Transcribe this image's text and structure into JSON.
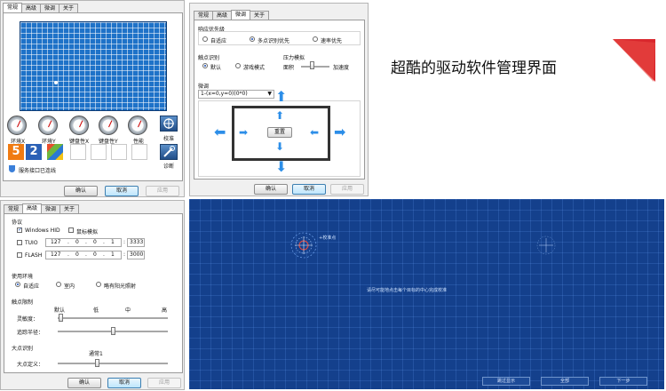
{
  "headline": "超酷的驱动软件管理界面",
  "colors": {
    "accent_red": "#d9272d",
    "grid_blue": "#1e72c8",
    "calib_bg": "#14408c"
  },
  "panel_general": {
    "tabs": [
      "常规",
      "高级",
      "微调",
      "关于"
    ],
    "gauges": [
      "环境X",
      "环境Y",
      "键盘性X",
      "键盘性Y",
      "性能"
    ],
    "calibrate_label": "校准",
    "diagnose_label": "诊断",
    "status_text": "服务接口已连线",
    "ok": "确认",
    "cancel": "取消",
    "apply": "应用"
  },
  "panel_tune": {
    "tabs": [
      "常规",
      "高级",
      "微调",
      "关于"
    ],
    "priority_title": "响应优先级",
    "priority_options": [
      "自适应",
      "多点识别优先",
      "速率优先"
    ],
    "touch_title": "触点识别",
    "touch_options": [
      "默认",
      "游戏模式"
    ],
    "pressure_title": "压力模拟",
    "pressure_left": "面积",
    "pressure_right": "加速度",
    "tune_title": "微调",
    "tune_select": "1-(x=0,y=0)(0*0)",
    "reset_label": "重置",
    "ok": "确认",
    "cancel": "取消",
    "apply": "应用"
  },
  "panel_adv": {
    "tabs": [
      "常规",
      "高级",
      "微调",
      "关于"
    ],
    "protocol_title": "协议",
    "windows_hid": "Windows HID",
    "mouse_sim": "鼠标模拟",
    "tuio_label": "TUIO",
    "tuio_ip": [
      "127",
      "0",
      "0",
      "1"
    ],
    "tuio_port": "3333",
    "flash_label": "FLASH",
    "flash_ip": [
      "127",
      "0",
      "0",
      "1"
    ],
    "flash_port": "3000",
    "env_title": "使用环境",
    "env_options": [
      "自适应",
      "室内",
      "略有阳光照射"
    ],
    "touch_limit_title": "触点限制",
    "scale_labels": [
      "默认",
      "低",
      "中",
      "高"
    ],
    "sensitivity_label": "灵敏度：",
    "track_radius_label": "追踪半径：",
    "big_point_title": "大点识别",
    "big_point_scale": "通常1",
    "big_point_label": "大点定义：",
    "ok": "确认",
    "cancel": "取消",
    "apply": "应用"
  },
  "calibration": {
    "instruction": "请尽可能地点击每个目标的中心完成校准",
    "target1_label": "+校准点",
    "buttons": [
      "跳过显示",
      "全部",
      "下一步"
    ]
  }
}
